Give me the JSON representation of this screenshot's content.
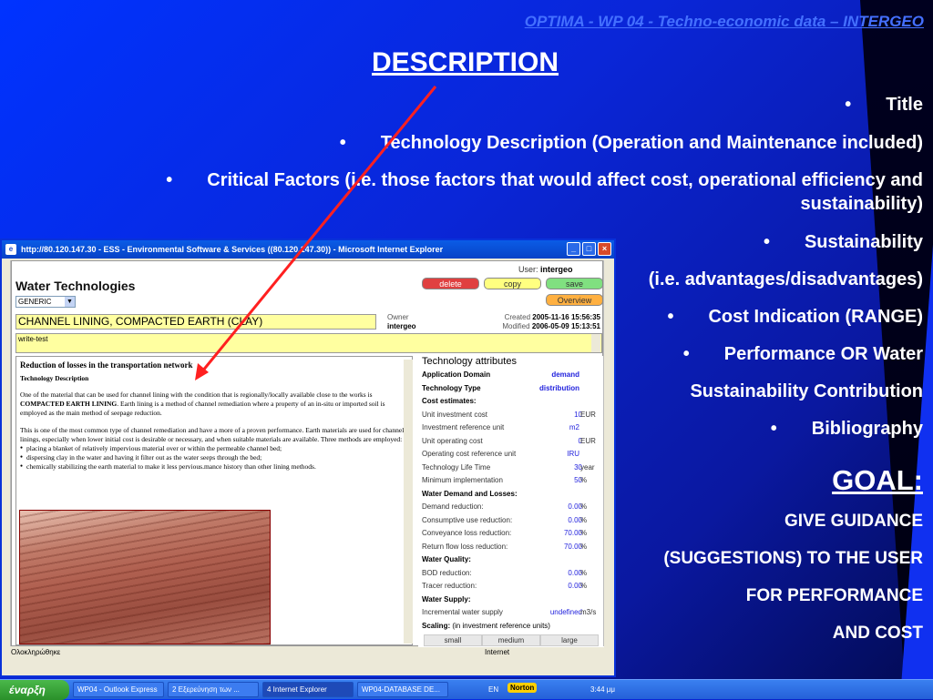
{
  "slide": {
    "header": "OPTIMA - WP 04 - Techno-economic data – INTERGEO",
    "heading": "DESCRIPTION",
    "items": [
      "Title",
      "Technology Description (Operation and Maintenance included)",
      "Critical Factors (i.e. those factors that would affect cost, operational efficiency and",
      "sustainability)",
      "Sustainability",
      "(i.e. advantages/disadvantages)",
      "Cost Indication (RANGE)",
      "Performance OR Water",
      "Sustainability Contribution",
      "Bibliography"
    ],
    "goal_heading": "GOAL:",
    "goal_lines": [
      "GIVE GUIDANCE",
      "(SUGGESTIONS) TO THE USER",
      "FOR PERFORMANCE",
      "AND COST"
    ],
    "colors": {
      "header": "#4470ff",
      "text": "#ffffff",
      "arrow": "#ff2020"
    }
  },
  "window": {
    "title": "http://80.120.147.30 - ESS - Environmental Software & Services ((80.120.147.30)) - Microsoft Internet Explorer",
    "buttons": {
      "minimize": "_",
      "maximize": "□",
      "close": "×"
    },
    "status_left": "Ολοκληρώθηκε",
    "status_zone": "Internet"
  },
  "app": {
    "title": "Water Technologies",
    "user_label": "User:",
    "user": "intergeo",
    "delete_label": "delete",
    "copy_label": "copy",
    "save_label": "save",
    "overview_label": "Overview",
    "type_select": "GENERIC",
    "tech_name": "CHANNEL LINING, COMPACTED EARTH (CLAY)",
    "owner_label": "Owner",
    "owner": "intergeo",
    "created_label": "Created",
    "created": "2005-11-16 15:56:35",
    "modified_label": "Modified",
    "modified": "2006-05-09 15:13:51",
    "note": "write-test"
  },
  "description": {
    "heading": "Reduction of losses in the transportation network",
    "subheading": "Technology Description",
    "p1a": "One of the material that can be used for channel lining with the condition that is regionally/locally available close to the works is ",
    "p1b": "COMPACTED EARTH LINING",
    "p1c": ". Earth lining is a method of channel remediation where a property of an in-situ or imported soil is employed as the main method of seepage reduction.",
    "p2": "This is one of the most common type of channel remediation and have a more of a proven performance. Earth materials are used for channel linings, especially when lower initial cost is desirable or necessary, and when suitable materials are available. Three methods are employed:",
    "bullets": [
      "placing a blanket of relatively impervious material over or within the permeable channel bed;",
      "dispersing clay in the water and having it filter out as the water seeps through the bed;",
      "chemically stabilizing the earth material to make it less pervious.mance history than other lining methods."
    ]
  },
  "attributes": {
    "title": "Technology attributes",
    "rows": [
      {
        "label": "Application Domain",
        "value": "demand",
        "unit": "",
        "bold": true
      },
      {
        "label": "Technology Type",
        "value": "distribution",
        "unit": "",
        "bold": true
      },
      {
        "label": "Cost estimates:",
        "value": "",
        "unit": "",
        "bold": true
      },
      {
        "label": "Unit investment cost",
        "value": "10",
        "unit": "EUR",
        "bold": false
      },
      {
        "label": "Investment reference unit",
        "value": "m2",
        "unit": "",
        "bold": false
      },
      {
        "label": "Unit operating cost",
        "value": "0",
        "unit": "EUR",
        "bold": false
      },
      {
        "label": "Operating cost reference unit",
        "value": "IRU",
        "unit": "",
        "bold": false
      },
      {
        "label": "Technology Life Time",
        "value": "30",
        "unit": "year",
        "bold": false
      },
      {
        "label": "Minimum implementation",
        "value": "50",
        "unit": "%",
        "bold": false
      },
      {
        "label": "Water Demand and Losses:",
        "value": "",
        "unit": "",
        "bold": true
      },
      {
        "label": "Demand reduction:",
        "value": "0.00",
        "unit": "%",
        "bold": false
      },
      {
        "label": "Consumptive use reduction:",
        "value": "0.00",
        "unit": "%",
        "bold": false
      },
      {
        "label": "Conveyance loss reduction:",
        "value": "70.00",
        "unit": "%",
        "bold": false
      },
      {
        "label": "Return flow loss reduction:",
        "value": "70.00",
        "unit": "%",
        "bold": false
      },
      {
        "label": "Water Quality:",
        "value": "",
        "unit": "",
        "bold": true
      },
      {
        "label": "BOD reduction:",
        "value": "0.00",
        "unit": "%",
        "bold": false
      },
      {
        "label": "Tracer reduction:",
        "value": "0.00",
        "unit": "%",
        "bold": false
      },
      {
        "label": "Water Supply:",
        "value": "",
        "unit": "",
        "bold": true
      },
      {
        "label": "Incremental water supply",
        "value": "undefined",
        "unit": "m3/s",
        "bold": false
      }
    ],
    "scaling_label": "Scaling:",
    "scaling_note": "(in investment reference units)",
    "scaling_cols": [
      "small",
      "medium",
      "large"
    ]
  },
  "taskbar": {
    "start": "έναρξη",
    "items": [
      "WP04 - Outlook Express",
      "2 Εξερεύνηση των ...",
      "4 Internet Explorer",
      "WP04-DATABASE DE..."
    ],
    "lang": "EN",
    "norton": "Norton",
    "clock": "3:44 μμ"
  }
}
